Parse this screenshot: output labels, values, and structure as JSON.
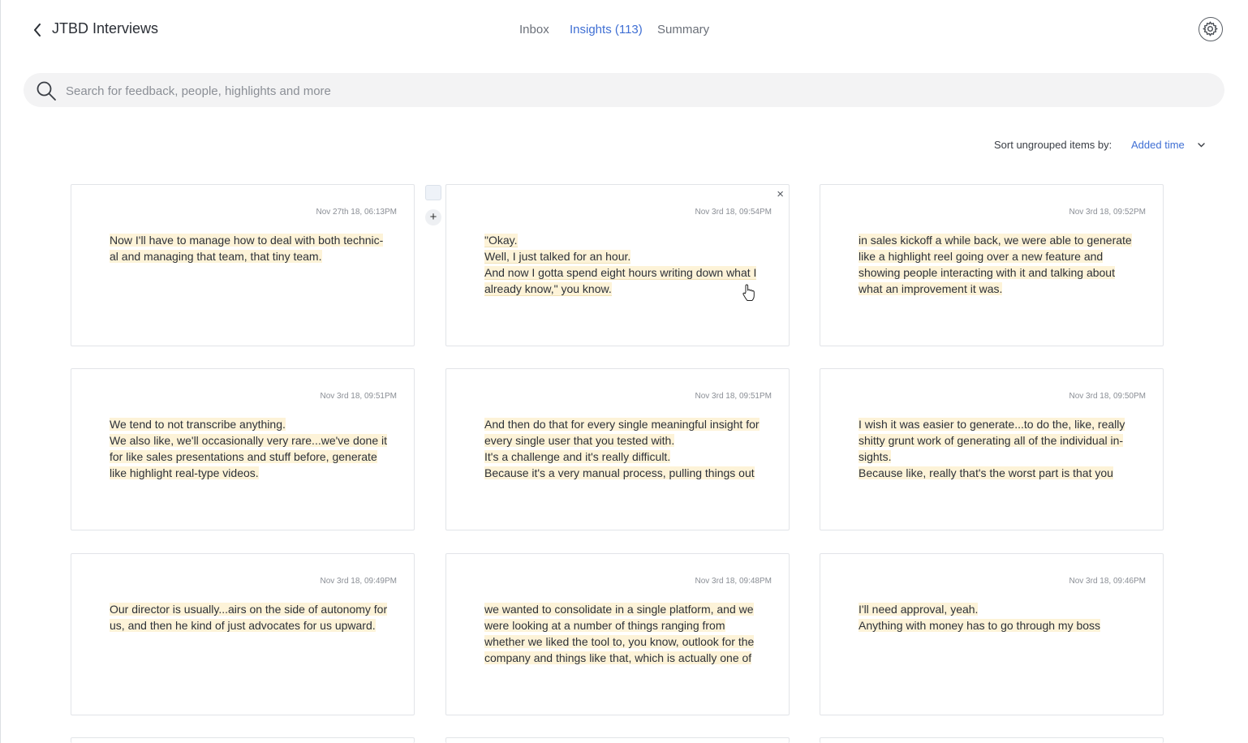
{
  "header": {
    "title": "JTBD Interviews",
    "tabs": [
      {
        "label": "Inbox",
        "active": false
      },
      {
        "label": "Insights (113)",
        "active": true
      },
      {
        "label": "Summary",
        "active": false
      }
    ]
  },
  "search": {
    "placeholder": "Search for feedback, people, highlights and more"
  },
  "sort": {
    "label": "Sort ungrouped items by:",
    "value": "Added time"
  },
  "colors": {
    "accent": "#3f6fd4",
    "highlight": "#fdf3d8",
    "border": "#e2e4e8"
  },
  "cards": [
    {
      "timestamp": "Nov 27th 18, 06:13PM",
      "text": "Now I'll have to manage how to deal with both technic-\nal and managing that team, that tiny team."
    },
    {
      "timestamp": "Nov 3rd 18, 09:54PM",
      "text": "\"Okay.\nWell, I just talked for an hour.\nAnd now I gotta spend eight hours writing down what I\nalready know,\" you know."
    },
    {
      "timestamp": "Nov 3rd 18, 09:52PM",
      "text": "in sales kickoff a while back, we were able to generate\nlike a highlight reel going over a new feature and\nshowing people interacting with it and talking about\nwhat an improvement it was."
    },
    {
      "timestamp": "Nov 3rd 18, 09:51PM",
      "text": "We tend to not transcribe anything.\nWe also like, we'll occasionally very rare...we've done it\nfor like sales presentations and stuff before, generate\nlike highlight real-type videos."
    },
    {
      "timestamp": "Nov 3rd 18, 09:51PM",
      "text": "And then do that for every single meaningful insight for\nevery single user that you tested with.\nIt's a challenge and it's really difficult.\nBecause it's a very manual process, pulling things out"
    },
    {
      "timestamp": "Nov 3rd 18, 09:50PM",
      "text": "I wish it was easier to generate...to do the, like, really\nshitty grunt work of generating all of the individual in-\nsights.\nBecause like, really that's the worst part is that you"
    },
    {
      "timestamp": "Nov 3rd 18, 09:49PM",
      "text": "Our director is usually...airs on the side of autonomy for\nus, and then he kind of just advocates for us upward."
    },
    {
      "timestamp": "Nov 3rd 18, 09:48PM",
      "text": "we wanted to consolidate in a single platform, and we\nwere looking at a number of things ranging from\nwhether we liked the tool to, you know, outlook for the\ncompany and things like that, which is actually one of"
    },
    {
      "timestamp": "Nov 3rd 18, 09:46PM",
      "text": "I'll need approval, yeah.\nAnything with money has to go through my boss"
    }
  ],
  "controls": {
    "close_glyph": "×",
    "add_glyph": "+"
  }
}
